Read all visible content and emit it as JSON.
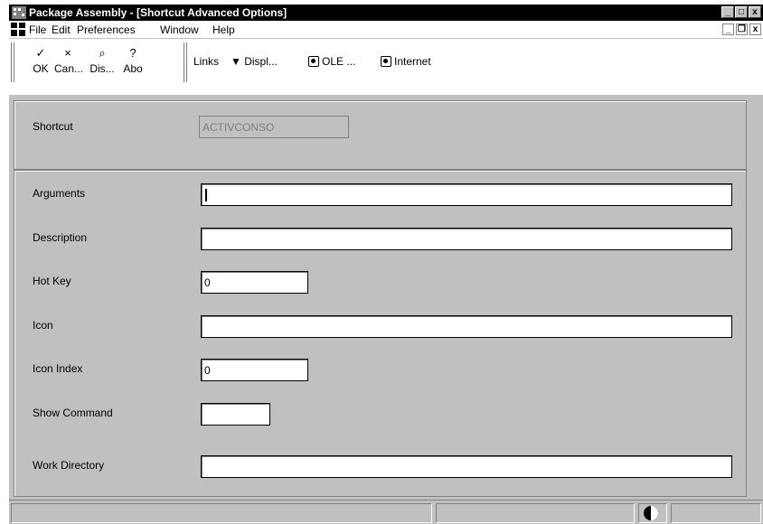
{
  "window": {
    "title": "Package Assembly - [Shortcut Advanced Options]",
    "controls": {
      "minimize": "_",
      "restore": "□",
      "close": "x"
    },
    "mdi_controls": {
      "minimize": "_",
      "restore": "❐",
      "close": "x"
    }
  },
  "menu": {
    "items": [
      "File",
      "Edit",
      "Preferences",
      "Window",
      "Help"
    ]
  },
  "toolbar": {
    "buttons": [
      {
        "icon": "✓",
        "label": "OK"
      },
      {
        "icon": "×",
        "label": "Can..."
      },
      {
        "icon": "⌕",
        "label": "Dis..."
      },
      {
        "icon": "?",
        "label": "Abo"
      }
    ],
    "links_label": "Links",
    "display_label": "Displ...",
    "ole_label": "OLE ...",
    "internet_label": "Internet"
  },
  "form": {
    "shortcut": {
      "label": "Shortcut",
      "value": "ACTIVCONSO"
    },
    "arguments": {
      "label": "Arguments",
      "value": ""
    },
    "description": {
      "label": "Description",
      "value": ""
    },
    "hot_key": {
      "label": "Hot Key",
      "value": "0"
    },
    "icon": {
      "label": "Icon",
      "value": ""
    },
    "icon_index": {
      "label": "Icon Index",
      "value": "0"
    },
    "show_command": {
      "label": "Show Command",
      "value": ""
    },
    "work_directory": {
      "label": "Work Directory",
      "value": ""
    }
  }
}
